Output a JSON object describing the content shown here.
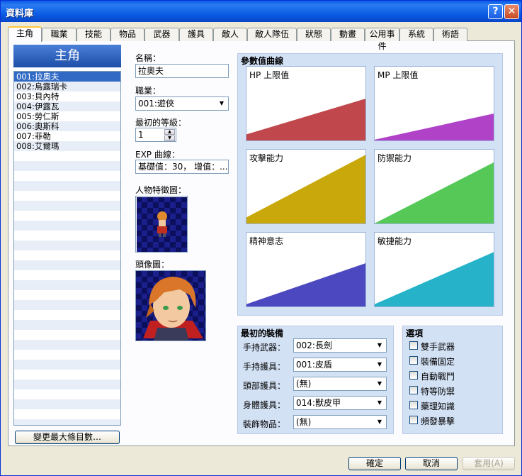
{
  "window": {
    "title": "資料庫"
  },
  "tabs": [
    "主角",
    "職業",
    "技能",
    "物品",
    "武器",
    "護具",
    "敵人",
    "敵人隊伍",
    "狀態",
    "動畫",
    "公用事件",
    "系統",
    "術語"
  ],
  "left_panel": {
    "header": "主角",
    "items": [
      "001:拉奧夫",
      "002:烏露瑞卡",
      "003:貝內特",
      "004:伊露瓦",
      "005:勞仁斯",
      "006:奧斯科",
      "007:菲勒",
      "008:艾爾瑪"
    ],
    "change_max_button": "變更最大條目數…"
  },
  "fields": {
    "name_label": "名稱：",
    "name_value": "拉奧夫",
    "class_label": "職業：",
    "class_value": "001:遊俠",
    "initial_level_label": "最初的等級：",
    "initial_level_value": "1",
    "exp_label": "EXP 曲線：",
    "exp_value": "基礎值：30， 增值：...",
    "character_graphic_label": "人物特徵圖：",
    "face_graphic_label": "頭像圖："
  },
  "params": {
    "title": "參數值曲線",
    "curves": [
      {
        "name": "HP 上限值",
        "color": "#c0474b",
        "start": 0.1,
        "end": 0.58
      },
      {
        "name": "MP 上限值",
        "color": "#b042c8",
        "start": 0.03,
        "end": 0.38
      },
      {
        "name": "攻擊能力",
        "color": "#c8a80a",
        "start": 0.1,
        "end": 0.94
      },
      {
        "name": "防禦能力",
        "color": "#55c858",
        "start": 0.02,
        "end": 0.84
      },
      {
        "name": "精神意志",
        "color": "#4b48c0",
        "start": 0.05,
        "end": 0.6
      },
      {
        "name": "敏捷能力",
        "color": "#26b3c9",
        "start": 0.05,
        "end": 0.75
      }
    ]
  },
  "equipment": {
    "title": "最初的裝備",
    "rows": [
      {
        "label": "手持武器：",
        "value": "002:長劍"
      },
      {
        "label": "手持護具：",
        "value": "001:皮盾"
      },
      {
        "label": "頭部護具：",
        "value": "(無)"
      },
      {
        "label": "身體護具：",
        "value": "014:獸皮甲"
      },
      {
        "label": "裝飾物品：",
        "value": "(無)"
      }
    ]
  },
  "options": {
    "title": "選項",
    "items": [
      "雙手武器",
      "裝備固定",
      "自動戰鬥",
      "特等防禦",
      "藥理知識",
      "頻發暴擊"
    ]
  },
  "buttons": {
    "ok": "確定",
    "cancel": "取消",
    "apply": "套用(A)"
  }
}
